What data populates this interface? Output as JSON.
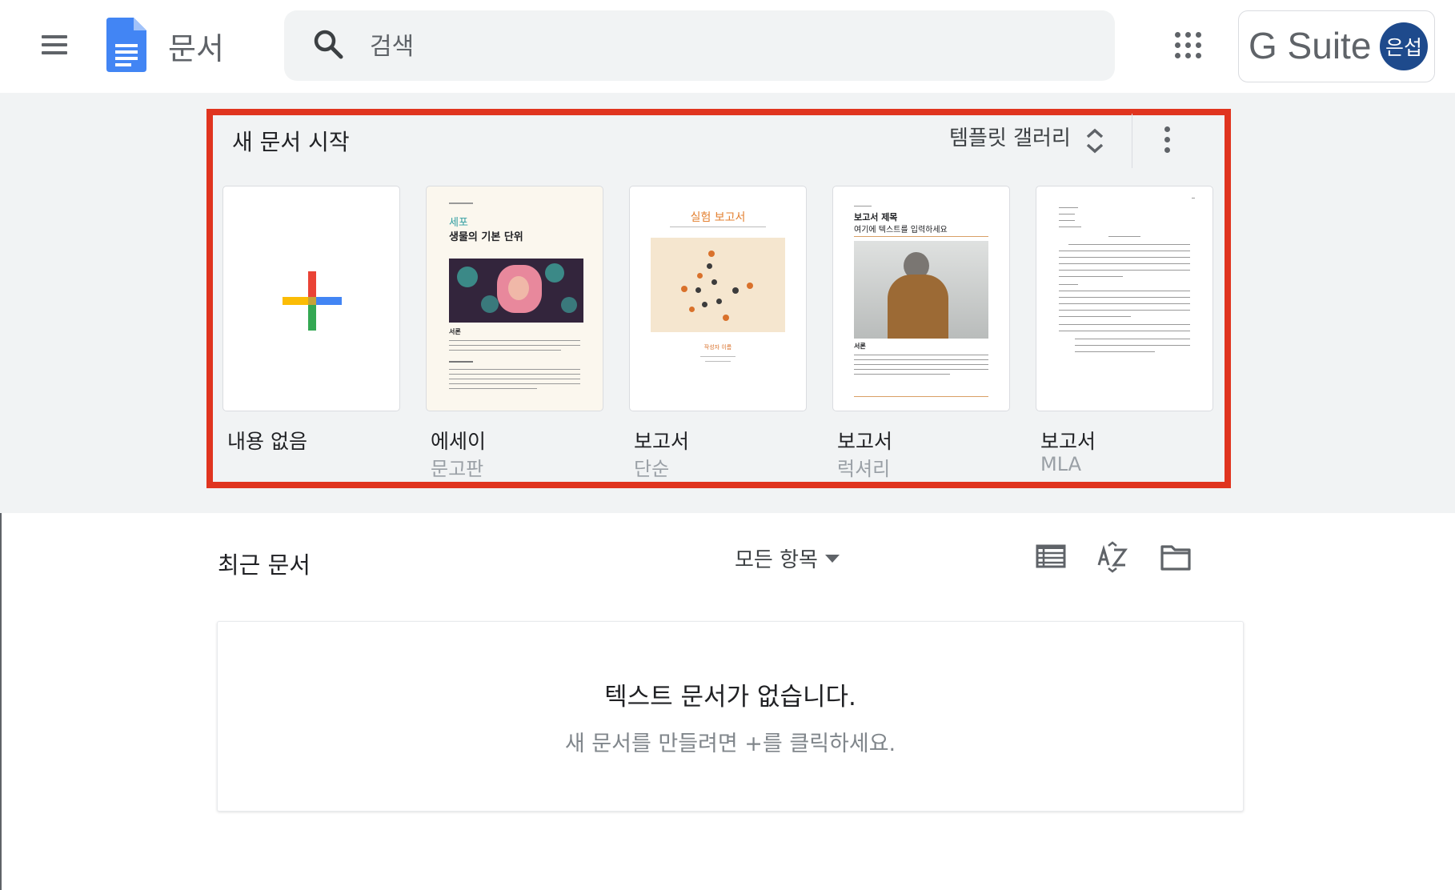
{
  "app": {
    "title": "문서"
  },
  "search": {
    "placeholder": "검색"
  },
  "account": {
    "brand": "G Suite",
    "avatar_text": "은섭"
  },
  "templates": {
    "section_title": "새 문서 시작",
    "gallery_label": "템플릿 갤러리",
    "items": [
      {
        "label": "내용 없음",
        "sub": ""
      },
      {
        "label": "에세이",
        "sub": "문고판",
        "preview_title_small": "세포",
        "preview_title": "생물의 기본 단위",
        "preview_heading": "서론"
      },
      {
        "label": "보고서",
        "sub": "단순",
        "preview_title": "실험 보고서",
        "preview_author": "작성자 이름"
      },
      {
        "label": "보고서",
        "sub": "럭셔리",
        "preview_title": "보고서 제목",
        "preview_subtitle": "여기에 텍스트를 입력하세요",
        "preview_heading": "서론"
      },
      {
        "label": "보고서",
        "sub": "MLA"
      }
    ]
  },
  "recent": {
    "title": "최근 문서",
    "owner_filter": "모든 항목",
    "empty_title": "텍스트 문서가 없습니다.",
    "empty_subtitle": "새 문서를 만들려면 +를 클릭하세요."
  },
  "icons": {
    "menu": "menu-icon",
    "docs_logo": "docs-logo-icon",
    "search": "search-icon",
    "apps": "apps-grid-icon",
    "list_view": "list-view-icon",
    "sort": "sort-az-icon",
    "folder": "folder-icon",
    "more": "more-vert-icon",
    "gallery_toggle": "unfold-icon",
    "plus": "plus-icon"
  },
  "colors": {
    "docs_blue": "#4285f4",
    "avatar": "#1e4a8c",
    "highlight": "#e0341f",
    "band": "#f1f3f4"
  }
}
